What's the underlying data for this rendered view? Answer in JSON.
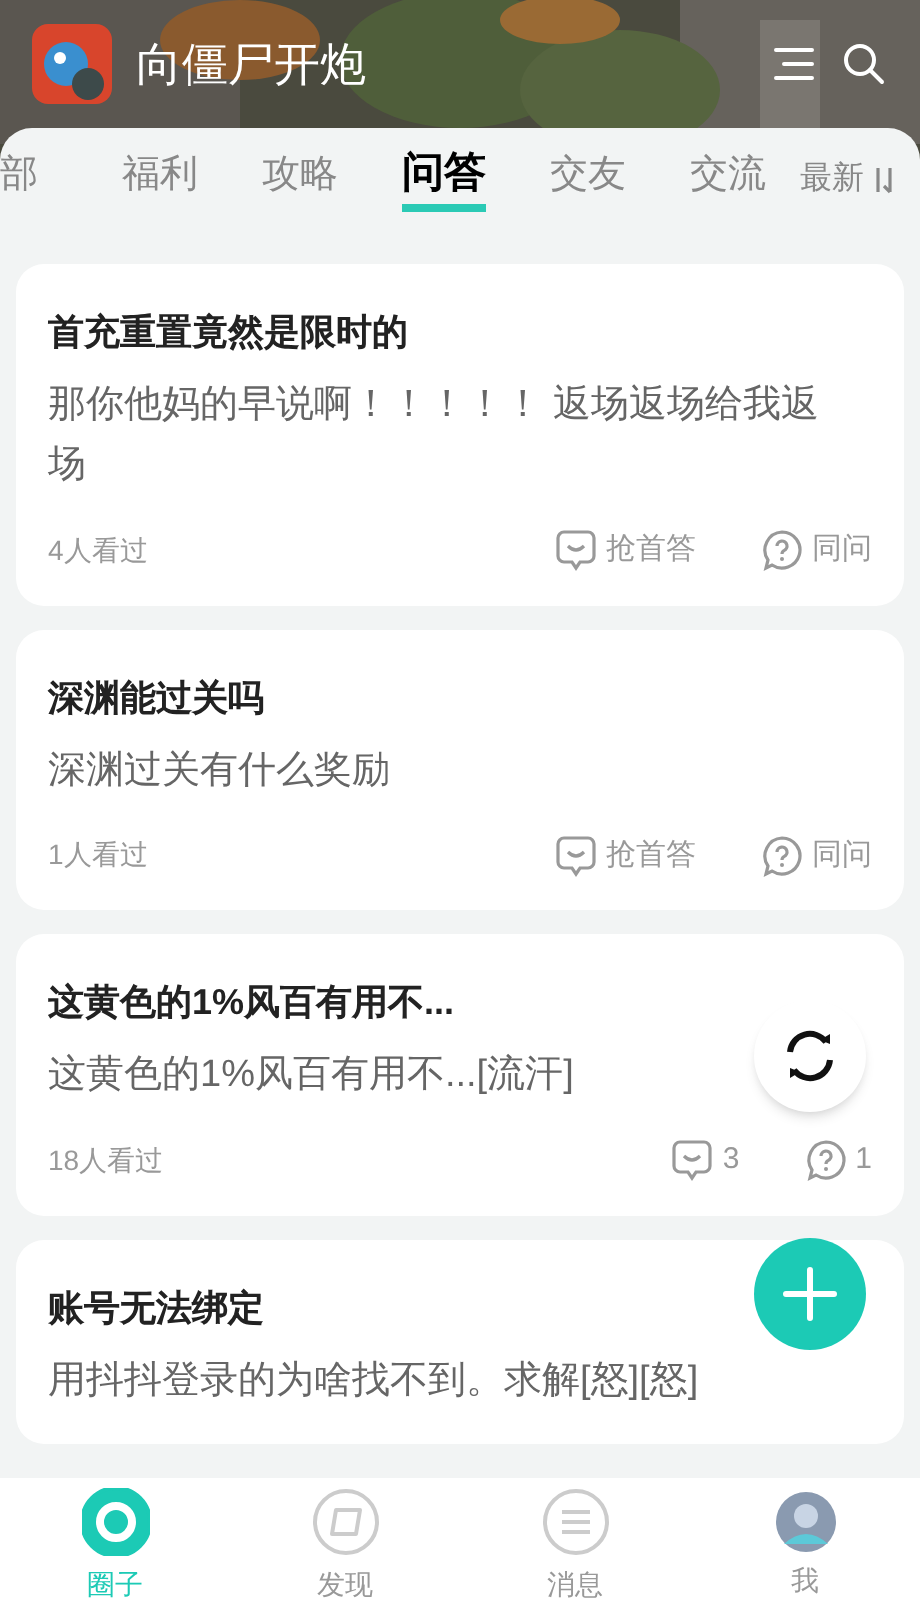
{
  "header": {
    "title": "向僵尸开炮"
  },
  "tabs": [
    {
      "label": "部",
      "selected": false
    },
    {
      "label": "福利",
      "selected": false
    },
    {
      "label": "攻略",
      "selected": false
    },
    {
      "label": "问答",
      "selected": true
    },
    {
      "label": "交友",
      "selected": false
    },
    {
      "label": "交流",
      "selected": false
    }
  ],
  "sort": {
    "label": "最新"
  },
  "posts": [
    {
      "title": "首充重置竟然是限时的",
      "body": "那你他妈的早说啊！！！！！ 返场返场给我返场",
      "views": "4人看过",
      "answer": "抢首答",
      "ask": "同问"
    },
    {
      "title": "深渊能过关吗",
      "body": "深渊过关有什么奖励",
      "views": "1人看过",
      "answer": "抢首答",
      "ask": "同问"
    },
    {
      "title": "这黄色的1%风百有用不...",
      "body": "这黄色的1%风百有用不...[流汗]",
      "views": "18人看过",
      "answer": "3",
      "ask": "1"
    },
    {
      "title": "账号无法绑定",
      "body": "用抖抖登录的为啥找不到。求解[怒][怒]"
    }
  ],
  "bottom_nav": [
    {
      "label": "圈子",
      "kind": "circle",
      "selected": true
    },
    {
      "label": "发现",
      "kind": "compass",
      "selected": false
    },
    {
      "label": "消息",
      "kind": "message",
      "selected": false
    },
    {
      "label": "我",
      "kind": "avatar",
      "selected": false
    }
  ]
}
